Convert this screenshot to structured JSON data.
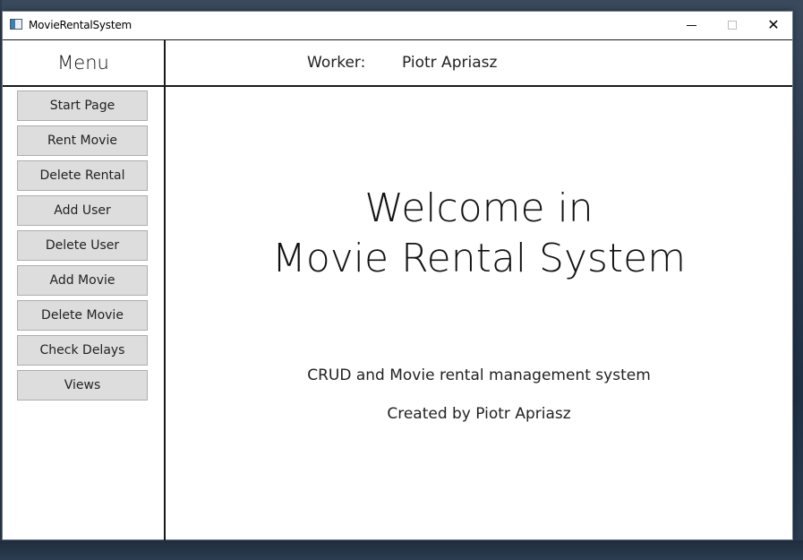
{
  "window": {
    "title": "MovieRentalSystem",
    "controls": {
      "minimize": "minimize-icon",
      "maximize": "maximize-icon",
      "close": "close-icon",
      "close_glyph": "✕"
    }
  },
  "menu": {
    "header": "Menu",
    "items": [
      {
        "label": "Start Page"
      },
      {
        "label": "Rent Movie"
      },
      {
        "label": "Delete Rental"
      },
      {
        "label": "Add User"
      },
      {
        "label": "Delete User"
      },
      {
        "label": "Add Movie"
      },
      {
        "label": "Delete Movie"
      },
      {
        "label": "Check Delays"
      },
      {
        "label": "Views"
      }
    ]
  },
  "header": {
    "worker_label": "Worker:",
    "worker_name": "Piotr Apriasz"
  },
  "main": {
    "welcome_line1": "Welcome in",
    "welcome_line2": "Movie Rental System",
    "subtitle": "CRUD and Movie rental management system",
    "credits": "Created by Piotr Apriasz"
  },
  "colors": {
    "button_bg": "#dddddd",
    "button_border": "#adadad",
    "desktop": "#2a3a4e"
  }
}
